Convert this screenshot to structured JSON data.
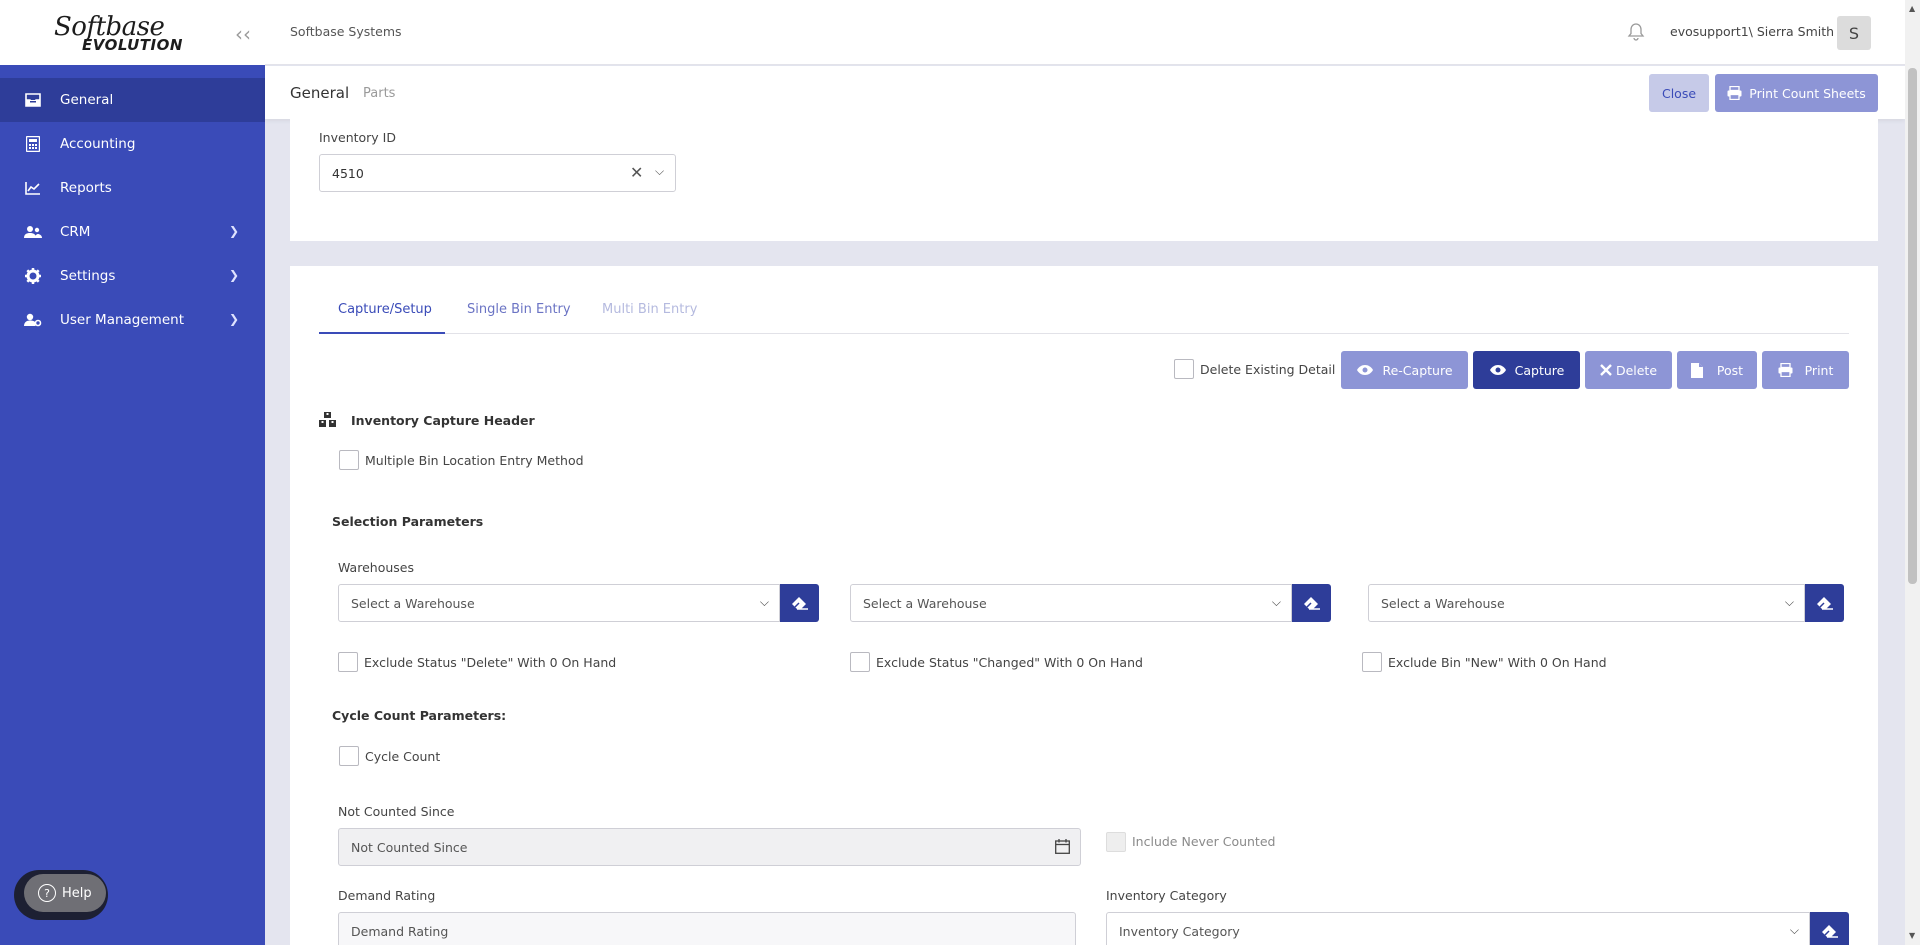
{
  "app": {
    "logo_line1": "Softbase",
    "logo_line2": "EVOLUTION",
    "company": "Softbase Systems",
    "user": "evosupport1\\ Sierra Smith",
    "avatar_letter": "S"
  },
  "sidebar": {
    "items": [
      {
        "label": "General",
        "icon": "inbox-icon",
        "active": true
      },
      {
        "label": "Accounting",
        "icon": "calculator-icon"
      },
      {
        "label": "Reports",
        "icon": "chart-line-icon"
      },
      {
        "label": "CRM",
        "icon": "users-icon",
        "has_children": true
      },
      {
        "label": "Settings",
        "icon": "gear-icon",
        "has_children": true
      },
      {
        "label": "User Management",
        "icon": "user-gear-icon",
        "has_children": true
      }
    ],
    "help_label": "Help"
  },
  "subbar": {
    "crumb_current": "General",
    "crumb_next": "Parts",
    "close_label": "Close",
    "print_count_label": "Print Count Sheets"
  },
  "inventory": {
    "label": "Inventory ID",
    "value": "4510"
  },
  "tabs": [
    {
      "label": "Capture/Setup",
      "state": "active"
    },
    {
      "label": "Single Bin Entry",
      "state": "normal"
    },
    {
      "label": "Multi Bin Entry",
      "state": "disabled"
    }
  ],
  "actions": {
    "delete_existing_label": "Delete Existing Detail",
    "recapture": "Re-Capture",
    "capture": "Capture",
    "delete": "Delete",
    "post": "Post",
    "print": "Print"
  },
  "capture_header": {
    "title": "Inventory Capture Header",
    "multi_bin_label": "Multiple Bin Location Entry Method"
  },
  "selection": {
    "title": "Selection Parameters",
    "warehouses_label": "Warehouses",
    "warehouse_placeholder": "Select a Warehouse",
    "exclude_delete": "Exclude Status \"Delete\" With 0 On Hand",
    "exclude_changed": "Exclude Status \"Changed\" With 0 On Hand",
    "exclude_new": "Exclude Bin \"New\" With 0 On Hand"
  },
  "cycle": {
    "title": "Cycle Count Parameters:",
    "cycle_count_label": "Cycle Count",
    "not_counted_label": "Not Counted Since",
    "not_counted_placeholder": "Not Counted Since",
    "include_never_label": "Include Never Counted",
    "demand_label": "Demand Rating",
    "demand_placeholder": "Demand Rating",
    "category_label": "Inventory Category",
    "category_placeholder": "Inventory Category"
  },
  "colors": {
    "sidebar": "#3a4bb8",
    "sidebar_active": "#2e3d99",
    "primary_dark": "#2e3d99",
    "primary_light": "#8d95d6"
  }
}
